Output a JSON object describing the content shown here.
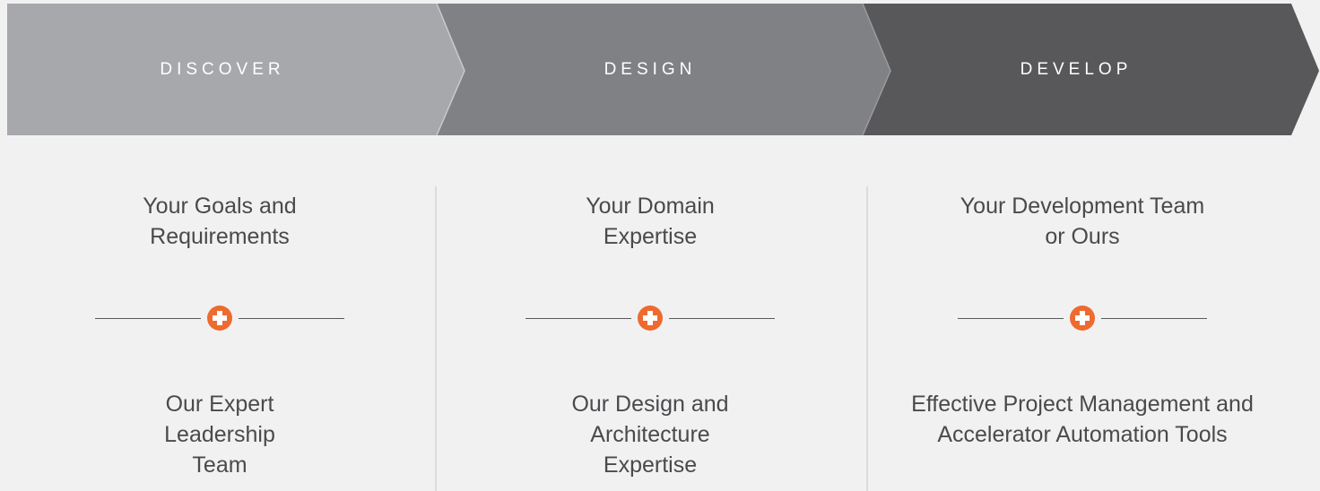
{
  "stages": [
    {
      "label": "DISCOVER",
      "color": "#a7a8ac",
      "top_text": "Your Goals and Requirements",
      "bottom_text": "Our Expert Leadership Team"
    },
    {
      "label": "DESIGN",
      "color": "#808184",
      "top_text": "Your Domain Expertise",
      "bottom_text": "Our Design and Architecture Expertise"
    },
    {
      "label": "DEVELOP",
      "color": "#58585a",
      "top_text": "Your Development Team or Ours",
      "bottom_text": "Effective Project Management and Accelerator Automation Tools"
    }
  ],
  "accent_color": "#ee6a2e",
  "plus_icon": "plus-circle-icon"
}
